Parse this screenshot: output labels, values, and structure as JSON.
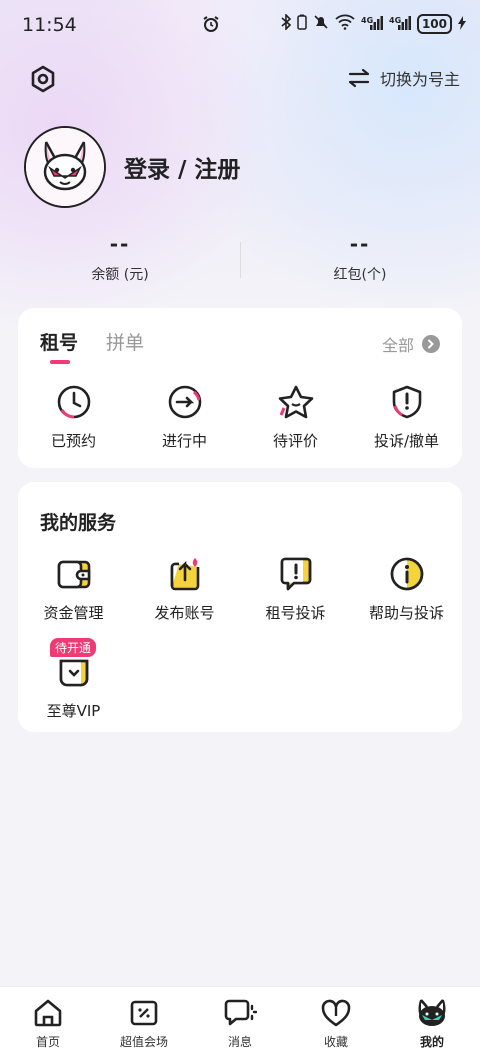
{
  "status_bar": {
    "time": "11:54",
    "battery": "100"
  },
  "header": {
    "switch_label": "切换为号主"
  },
  "profile": {
    "login_label": "登录 / 注册"
  },
  "stats": [
    {
      "value": "--",
      "label": "余额 (元)"
    },
    {
      "value": "--",
      "label": "红包(个)"
    }
  ],
  "orders": {
    "tabs": [
      {
        "label": "租号",
        "active": true
      },
      {
        "label": "拼单",
        "active": false
      }
    ],
    "all_label": "全部",
    "items": [
      {
        "label": "已预约",
        "icon": "clock-icon"
      },
      {
        "label": "进行中",
        "icon": "in-progress-icon"
      },
      {
        "label": "待评价",
        "icon": "star-icon"
      },
      {
        "label": "投诉/撤单",
        "icon": "shield-alert-icon"
      }
    ]
  },
  "services": {
    "title": "我的服务",
    "items": [
      {
        "label": "资金管理",
        "icon": "wallet-icon"
      },
      {
        "label": "发布账号",
        "icon": "publish-icon"
      },
      {
        "label": "租号投诉",
        "icon": "complaint-icon"
      },
      {
        "label": "帮助与投诉",
        "icon": "info-icon"
      }
    ],
    "vip": {
      "label": "至尊VIP",
      "badge": "待开通",
      "icon": "vip-icon"
    }
  },
  "bottom_nav": [
    {
      "label": "首页",
      "icon": "home-icon",
      "active": false
    },
    {
      "label": "超值会场",
      "icon": "ticket-icon",
      "active": false
    },
    {
      "label": "消息",
      "icon": "message-icon",
      "active": false
    },
    {
      "label": "收藏",
      "icon": "heart-icon",
      "active": false
    },
    {
      "label": "我的",
      "icon": "mine-icon",
      "active": true
    }
  ],
  "colors": {
    "accent": "#ee3b76",
    "yellow": "#f5d33a",
    "page_bg": "#f4f4f8"
  }
}
